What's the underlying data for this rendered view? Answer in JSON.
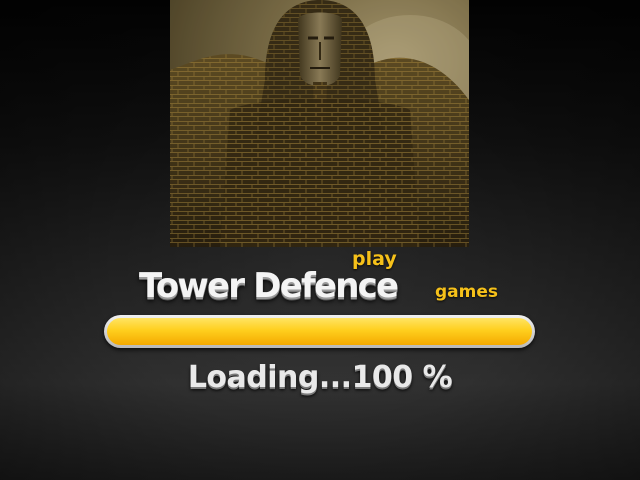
{
  "splash": {
    "artwork_icon": "sphinx-pharaoh-icon"
  },
  "logo": {
    "title": "Tower Defence",
    "play": "play",
    "games": "games"
  },
  "loader": {
    "progress_percent": 100,
    "label": "Loading...100 %"
  },
  "colors": {
    "accent": "#f6c11a",
    "bar_fill": "#ffcf1e",
    "bar_track": "#d8d8d8",
    "text": "#f0f0f0"
  }
}
